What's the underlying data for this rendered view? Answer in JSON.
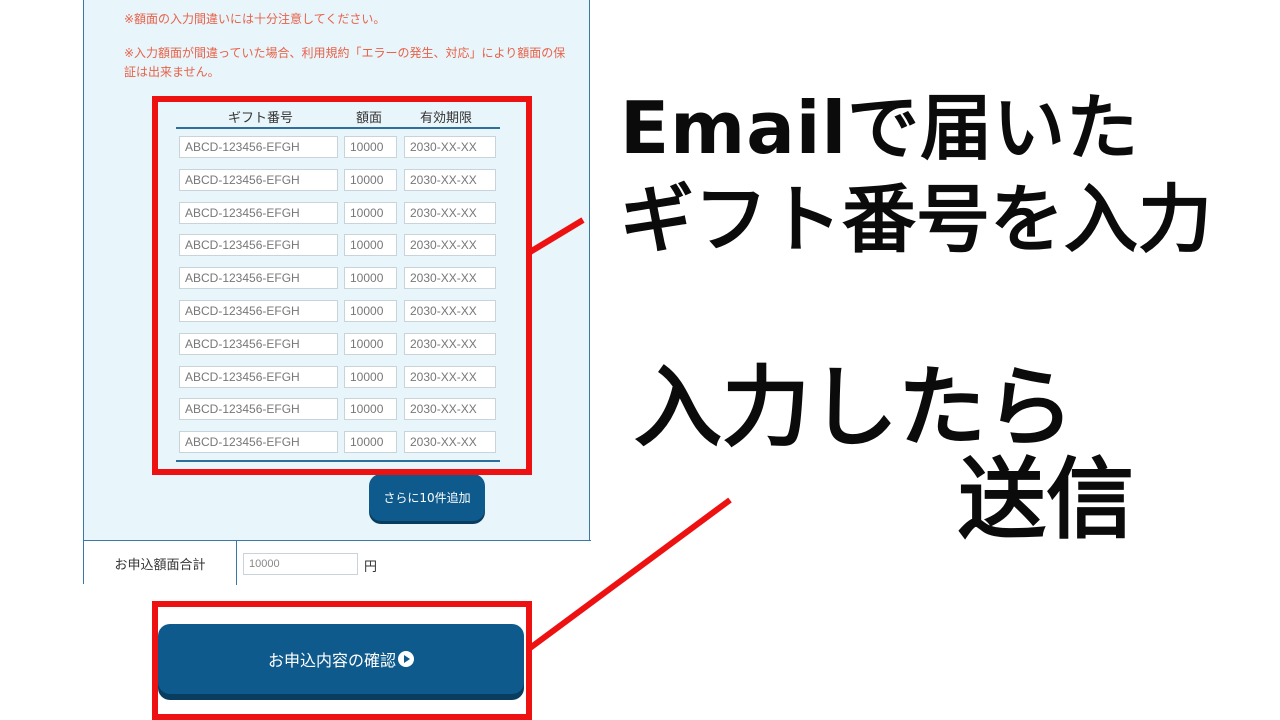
{
  "notices": [
    "※額面の入力間違いには十分注意してください。",
    "※入力額面が間違っていた場合、利用規約「エラーの発生、対応」により額面の保証は出来ません。"
  ],
  "gift_table": {
    "headers": {
      "code": "ギフト番号",
      "amount": "額面",
      "expiry": "有効期限"
    },
    "rows": [
      {
        "code": "ABCD-123456-EFGH",
        "amount": "10000",
        "expiry": "2030-XX-XX"
      },
      {
        "code": "ABCD-123456-EFGH",
        "amount": "10000",
        "expiry": "2030-XX-XX"
      },
      {
        "code": "ABCD-123456-EFGH",
        "amount": "10000",
        "expiry": "2030-XX-XX"
      },
      {
        "code": "ABCD-123456-EFGH",
        "amount": "10000",
        "expiry": "2030-XX-XX"
      },
      {
        "code": "ABCD-123456-EFGH",
        "amount": "10000",
        "expiry": "2030-XX-XX"
      },
      {
        "code": "ABCD-123456-EFGH",
        "amount": "10000",
        "expiry": "2030-XX-XX"
      },
      {
        "code": "ABCD-123456-EFGH",
        "amount": "10000",
        "expiry": "2030-XX-XX"
      },
      {
        "code": "ABCD-123456-EFGH",
        "amount": "10000",
        "expiry": "2030-XX-XX"
      },
      {
        "code": "ABCD-123456-EFGH",
        "amount": "10000",
        "expiry": "2030-XX-XX"
      },
      {
        "code": "ABCD-123456-EFGH",
        "amount": "10000",
        "expiry": "2030-XX-XX"
      }
    ]
  },
  "add_more_button": "さらに10件追加",
  "total": {
    "label": "お申込額面合計",
    "value": "10000",
    "unit": "円"
  },
  "confirm_button": "お申込内容の確認",
  "callouts": {
    "line1": "Emailで届いた",
    "line2": "ギフト番号を入力",
    "line3": "入力したら",
    "line4": "送信"
  },
  "colors": {
    "accent_red": "#ee1111",
    "button_blue": "#0e5a8c",
    "panel_bg": "#e8f5fa",
    "notice_text": "#e8624a"
  }
}
